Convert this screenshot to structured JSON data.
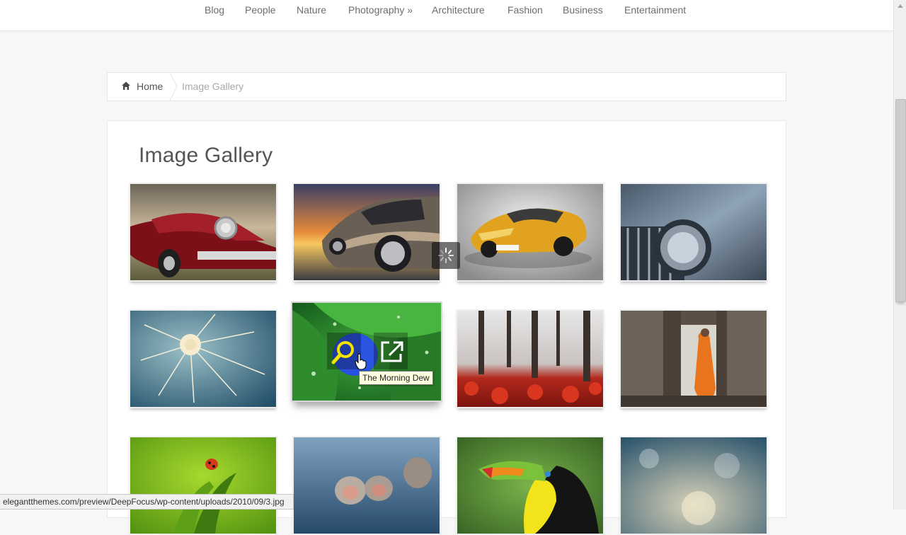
{
  "nav": {
    "items": [
      "Blog",
      "People",
      "Nature",
      "Photography »",
      "Architecture",
      "Fashion",
      "Business",
      "Entertainment"
    ]
  },
  "breadcrumb": {
    "home": "Home",
    "current": "Image Gallery"
  },
  "page": {
    "title": "Image Gallery"
  },
  "gallery": {
    "thumbnails": [
      {
        "subject": "red-classic-car"
      },
      {
        "subject": "silver-car-at-sunset"
      },
      {
        "subject": "yellow-sports-car"
      },
      {
        "subject": "car-headlight"
      },
      {
        "subject": "dandelion"
      },
      {
        "subject": "morning-dew-leaf"
      },
      {
        "subject": "red-forest"
      },
      {
        "subject": "monk-in-temple"
      },
      {
        "subject": "ladybug-on-leaf"
      },
      {
        "subject": "snow-monkeys"
      },
      {
        "subject": "toucan"
      },
      {
        "subject": "bokeh-light"
      }
    ],
    "hover_tooltip": "The Morning Dew"
  },
  "status_bar": {
    "url": "elegantthemes.com/preview/DeepFocus/wp-content/uploads/2010/09/3.jpg"
  },
  "icons": {
    "home": "home-icon",
    "zoom": "magnifier-icon",
    "open": "external-link-icon",
    "loading": "spinner-icon",
    "cursor": "hand-pointer-icon"
  },
  "colors": {
    "accent_yellow": "#f2e400",
    "zoom_ring": "#2846ff",
    "tooltip_bg": "#ffffe1"
  }
}
